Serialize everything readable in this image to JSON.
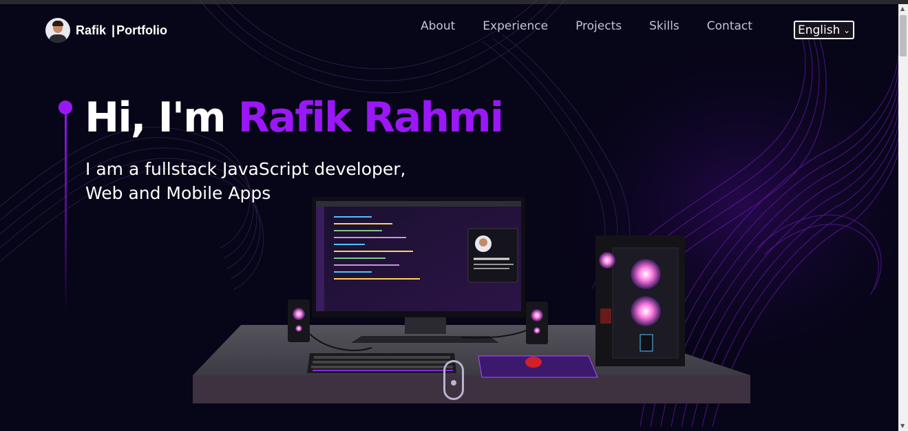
{
  "brand": {
    "name": "Rafik",
    "separator": "|",
    "suffix": "Portfolio"
  },
  "nav": {
    "items": [
      "About",
      "Experience",
      "Projects",
      "Skills",
      "Contact"
    ]
  },
  "language": {
    "selected": "English"
  },
  "hero": {
    "greeting": "Hi, I'm ",
    "name": "Rafik Rahmi",
    "subtitle_line1": "I am a fullstack JavaScript developer,",
    "subtitle_line2": "Web and Mobile Apps"
  },
  "colors": {
    "accent": "#9b17f7",
    "background": "#070518",
    "nav_text": "#c7c3d6"
  },
  "icons": [
    "avatar",
    "chevron-down-icon",
    "scroll-mouse-icon"
  ]
}
